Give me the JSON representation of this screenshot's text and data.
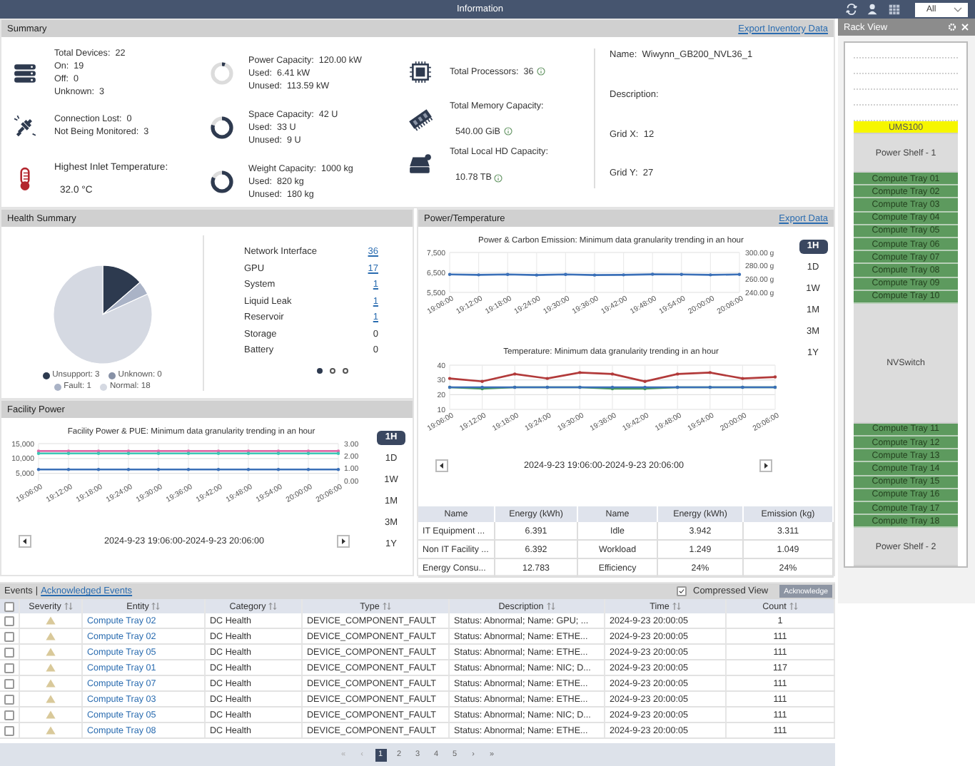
{
  "topbar": {
    "title": "Information",
    "filter": "All"
  },
  "summary": {
    "title": "Summary",
    "export": "Export Inventory Data",
    "devices": [
      {
        "label": "Total Devices:",
        "value": "22"
      },
      {
        "label": "On:",
        "value": "19"
      },
      {
        "label": "Off:",
        "value": "0"
      },
      {
        "label": "Unknown:",
        "value": "3"
      }
    ],
    "connection": [
      {
        "label": "Connection Lost:",
        "value": "0"
      },
      {
        "label": "Not Being Monitored:",
        "value": "3"
      }
    ],
    "temperature": {
      "label": "Highest Inlet Temperature:",
      "value": "32.0 °C"
    },
    "capacities": [
      {
        "label": "Power Capacity:",
        "value": "120.00 kW",
        "level": 0.05,
        "lines": [
          {
            "label": "Used:",
            "value": "6.41 kW"
          },
          {
            "label": "Unused:",
            "value": "113.59 kW"
          }
        ]
      },
      {
        "label": "Space Capacity:",
        "value": "42 U",
        "level": 0.79,
        "lines": [
          {
            "label": "Used:",
            "value": "33 U"
          },
          {
            "label": "Unused:",
            "value": "9 U"
          }
        ]
      },
      {
        "label": "Weight Capacity:",
        "value": "1000 kg",
        "level": 0.82,
        "lines": [
          {
            "label": "Used:",
            "value": "820 kg"
          },
          {
            "label": "Unused:",
            "value": "180 kg"
          }
        ]
      }
    ],
    "totals": [
      {
        "label": "Total Processors:",
        "value": "36",
        "kind": "inline"
      },
      {
        "label": "Total Memory Capacity:",
        "value": "540.00 GiB",
        "kind": "stacked"
      },
      {
        "label": "Total Local HD Capacity:",
        "value": "10.78 TB",
        "kind": "stacked"
      }
    ],
    "info": [
      {
        "label": "Name:",
        "value": "Wiwynn_GB200_NVL36_1"
      },
      {
        "label": "Description:"
      },
      {
        "label": "Grid X:",
        "value": "12"
      },
      {
        "label": "Grid Y:",
        "value": "27"
      }
    ]
  },
  "health": {
    "title": "Health Summary",
    "chart_data": {
      "type": "pie",
      "categories": [
        "Unsupport: 3",
        "Unknown: 0",
        "Fault: 1",
        "Normal: 18"
      ],
      "values": [
        3,
        0,
        1,
        18
      ]
    },
    "legend": [
      {
        "color": "#2d3a4f"
      },
      {
        "color": "#8791a6"
      },
      {
        "color": "#aab3c6"
      },
      {
        "color": "#d5d9e2"
      }
    ],
    "items": [
      {
        "label": "Network Interface",
        "value": "36",
        "link": true
      },
      {
        "label": "GPU",
        "value": "17",
        "link": true
      },
      {
        "label": "System",
        "value": "1",
        "link": true
      },
      {
        "label": "Liquid Leak",
        "value": "1",
        "link": true
      },
      {
        "label": "Reservoir",
        "value": "1",
        "link": true
      },
      {
        "label": "Storage",
        "value": "0",
        "link": false
      },
      {
        "label": "Battery",
        "value": "0",
        "link": false
      }
    ],
    "pages": [
      {
        "selected": true
      },
      {
        "selected": false
      },
      {
        "selected": false
      }
    ]
  },
  "power": {
    "title": "Power/Temperature",
    "export": "Export Data",
    "ranges": [
      {
        "label": "1H",
        "selected": true
      },
      {
        "label": "1D",
        "selected": false
      },
      {
        "label": "1W",
        "selected": false
      },
      {
        "label": "1M",
        "selected": false
      },
      {
        "label": "3M",
        "selected": false
      },
      {
        "label": "1Y",
        "selected": false
      }
    ],
    "charts": [
      {
        "chart_data": {
          "type": "line",
          "title": "Power & Carbon Emission: Minimum data granularity trending in an hour",
          "categories": [
            "19:06:00",
            "19:12:00",
            "19:18:00",
            "19:24:00",
            "19:30:00",
            "19:36:00",
            "19:42:00",
            "19:48:00",
            "19:54:00",
            "20:00:00",
            "20:06:00"
          ],
          "ylim": [
            5500,
            7500
          ],
          "yticks": [
            {
              "value": 5500,
              "label": "5,500"
            },
            {
              "value": 6500,
              "label": "6,500"
            },
            {
              "value": 7500,
              "label": "7,500"
            }
          ],
          "y2lim": [
            240,
            300
          ],
          "y2ticks": [
            {
              "value": 240,
              "label": "240.00 g"
            },
            {
              "value": 260,
              "label": "260.00 g"
            },
            {
              "value": 280,
              "label": "280.00 g"
            },
            {
              "value": 300,
              "label": "300.00 g"
            }
          ],
          "series": [
            {
              "color": "#3b70b8",
              "values": [
                6400,
                6380,
                6400,
                6370,
                6400,
                6370,
                6380,
                6410,
                6400,
                6380,
                6400
              ]
            }
          ]
        }
      },
      {
        "chart_data": {
          "type": "line",
          "title": "Temperature: Minimum data granularity trending in an hour",
          "categories": [
            "19:06:00",
            "19:12:00",
            "19:18:00",
            "19:24:00",
            "19:30:00",
            "19:36:00",
            "19:42:00",
            "19:48:00",
            "19:54:00",
            "20:00:00",
            "20:06:00"
          ],
          "ylim": [
            10,
            40
          ],
          "yticks": [
            10,
            20,
            30,
            40
          ],
          "series": [
            {
              "color": "#4a9a5a",
              "values": [
                25,
                24,
                25,
                25,
                25,
                24,
                24,
                25,
                25,
                25,
                25
              ]
            },
            {
              "color": "#3b70b8",
              "values": [
                25,
                25,
                25,
                25,
                25,
                25,
                25,
                25,
                25,
                25,
                25
              ]
            },
            {
              "color": "#b23a3a",
              "values": [
                31,
                29,
                34,
                31,
                35,
                34,
                29,
                34,
                35,
                31,
                32
              ]
            }
          ]
        }
      }
    ],
    "range_text": "2024-9-23 19:06:00-2024-9-23 20:06:00",
    "table": {
      "columns": [
        "Name",
        "Energy (kWh)",
        "Name",
        "Energy (kWh)",
        "Emission (kg)"
      ],
      "rows": [
        [
          "IT Equipment ...",
          "6.391",
          "Idle",
          "3.942",
          "3.311"
        ],
        [
          "Non IT Facility ...",
          "6.392",
          "Workload",
          "1.249",
          "1.049"
        ],
        [
          "Energy Consu...",
          "12.783",
          "Efficiency",
          "24%",
          "24%"
        ]
      ]
    }
  },
  "facility": {
    "title": "Facility Power",
    "ranges": [
      {
        "label": "1H",
        "selected": true
      },
      {
        "label": "1D",
        "selected": false
      },
      {
        "label": "1W",
        "selected": false
      },
      {
        "label": "1M",
        "selected": false
      },
      {
        "label": "3M",
        "selected": false
      },
      {
        "label": "1Y",
        "selected": false
      }
    ],
    "chart_data": {
      "type": "line",
      "title": "Facility Power & PUE: Minimum data granularity trending in an hour",
      "categories": [
        "19:06:00",
        "19:12:00",
        "19:18:00",
        "19:24:00",
        "19:30:00",
        "19:36:00",
        "19:42:00",
        "19:48:00",
        "19:54:00",
        "20:00:00",
        "20:06:00"
      ],
      "ylim": [
        2500,
        15000
      ],
      "yticks": [
        {
          "value": 5000,
          "label": "5,000"
        },
        {
          "value": 10000,
          "label": "10,000"
        },
        {
          "value": 15000,
          "label": "15,000"
        }
      ],
      "y2lim": [
        0,
        3
      ],
      "y2ticks": [
        {
          "value": 0,
          "label": "0.00"
        },
        {
          "value": 1,
          "label": "1.00"
        },
        {
          "value": 2,
          "label": "2.00"
        },
        {
          "value": 3,
          "label": "3.00"
        }
      ],
      "series": [
        {
          "color": "#e06aa8",
          "values": [
            12500,
            12500,
            12500,
            12500,
            12500,
            12500,
            12500,
            12500,
            12500,
            12500,
            12500
          ]
        },
        {
          "color": "#3cc7b5",
          "values": [
            11700,
            11700,
            11700,
            11700,
            11700,
            11700,
            11700,
            11700,
            11700,
            11700,
            11700
          ]
        },
        {
          "color": "#3b70b8",
          "values": [
            6300,
            6300,
            6300,
            6300,
            6300,
            6300,
            6300,
            6300,
            6300,
            6300,
            6300
          ]
        }
      ]
    },
    "range_text": "2024-9-23 19:06:00-2024-9-23 20:06:00"
  },
  "events": {
    "title": "Events",
    "separator": "|",
    "ack_link": "Acknowledged Events",
    "compressed": {
      "label": "Compressed View",
      "checked": true
    },
    "ack_button": "Acknowledge",
    "all_checked": false,
    "columns": [
      "Severity",
      "Entity",
      "Category",
      "Type",
      "Description",
      "Time",
      "Count"
    ],
    "rows": [
      {
        "checked": false,
        "entity": "Compute Tray 02",
        "category": "DC Health",
        "type": "DEVICE_COMPONENT_FAULT",
        "description": "Status: Abnormal; Name: GPU; ...",
        "time": "2024-9-23 20:00:05",
        "count": "1"
      },
      {
        "checked": false,
        "entity": "Compute Tray 02",
        "category": "DC Health",
        "type": "DEVICE_COMPONENT_FAULT",
        "description": "Status: Abnormal; Name: ETHE...",
        "time": "2024-9-23 20:00:05",
        "count": "111"
      },
      {
        "checked": false,
        "entity": "Compute Tray 05",
        "category": "DC Health",
        "type": "DEVICE_COMPONENT_FAULT",
        "description": "Status: Abnormal; Name: ETHE...",
        "time": "2024-9-23 20:00:05",
        "count": "111"
      },
      {
        "checked": false,
        "entity": "Compute Tray 01",
        "category": "DC Health",
        "type": "DEVICE_COMPONENT_FAULT",
        "description": "Status: Abnormal; Name: NIC; D...",
        "time": "2024-9-23 20:00:05",
        "count": "117"
      },
      {
        "checked": false,
        "entity": "Compute Tray 07",
        "category": "DC Health",
        "type": "DEVICE_COMPONENT_FAULT",
        "description": "Status: Abnormal; Name: ETHE...",
        "time": "2024-9-23 20:00:05",
        "count": "111"
      },
      {
        "checked": false,
        "entity": "Compute Tray 03",
        "category": "DC Health",
        "type": "DEVICE_COMPONENT_FAULT",
        "description": "Status: Abnormal; Name: ETHE...",
        "time": "2024-9-23 20:00:05",
        "count": "111"
      },
      {
        "checked": false,
        "entity": "Compute Tray 05",
        "category": "DC Health",
        "type": "DEVICE_COMPONENT_FAULT",
        "description": "Status: Abnormal; Name: NIC; D...",
        "time": "2024-9-23 20:00:05",
        "count": "111"
      },
      {
        "checked": false,
        "entity": "Compute Tray 08",
        "category": "DC Health",
        "type": "DEVICE_COMPONENT_FAULT",
        "description": "Status: Abnormal; Name: ETHE...",
        "time": "2024-9-23 20:00:05",
        "count": "111"
      }
    ],
    "pages": [
      {
        "label": "«",
        "selected": false,
        "disabled": true
      },
      {
        "label": "‹",
        "selected": false,
        "disabled": true
      },
      {
        "label": "1",
        "selected": true,
        "disabled": false
      },
      {
        "label": "2",
        "selected": false,
        "disabled": false
      },
      {
        "label": "3",
        "selected": false,
        "disabled": false
      },
      {
        "label": "4",
        "selected": false,
        "disabled": false
      },
      {
        "label": "5",
        "selected": false,
        "disabled": false
      },
      {
        "label": "›",
        "selected": false,
        "disabled": false
      },
      {
        "label": "»",
        "selected": false,
        "disabled": false
      }
    ]
  },
  "rack": {
    "title": "Rack View",
    "slots": [
      {
        "kind": "empty"
      },
      {
        "kind": "empty"
      },
      {
        "kind": "empty"
      },
      {
        "kind": "empty"
      },
      {
        "kind": "empty"
      },
      {
        "kind": "ums",
        "label": "UMS100"
      },
      {
        "kind": "shelf",
        "label": "Power Shelf - 1"
      },
      {
        "kind": "tray",
        "label": "Compute Tray 01"
      },
      {
        "kind": "tray",
        "label": "Compute Tray 02"
      },
      {
        "kind": "tray",
        "label": "Compute Tray 03"
      },
      {
        "kind": "tray",
        "label": "Compute Tray 04"
      },
      {
        "kind": "tray",
        "label": "Compute Tray 05"
      },
      {
        "kind": "tray",
        "label": "Compute Tray 06"
      },
      {
        "kind": "tray",
        "label": "Compute Tray 07"
      },
      {
        "kind": "tray",
        "label": "Compute Tray 08"
      },
      {
        "kind": "tray",
        "label": "Compute Tray 09"
      },
      {
        "kind": "tray",
        "label": "Compute Tray 10"
      },
      {
        "kind": "switch",
        "label": "NVSwitch"
      },
      {
        "kind": "tray",
        "label": "Compute Tray 11"
      },
      {
        "kind": "tray",
        "label": "Compute Tray 12"
      },
      {
        "kind": "tray",
        "label": "Compute Tray 13"
      },
      {
        "kind": "tray",
        "label": "Compute Tray 14"
      },
      {
        "kind": "tray",
        "label": "Compute Tray 15"
      },
      {
        "kind": "tray",
        "label": "Compute Tray 16"
      },
      {
        "kind": "tray",
        "label": "Compute Tray 17"
      },
      {
        "kind": "tray",
        "label": "Compute Tray 18"
      },
      {
        "kind": "shelf",
        "label": "Power Shelf - 2"
      }
    ]
  }
}
